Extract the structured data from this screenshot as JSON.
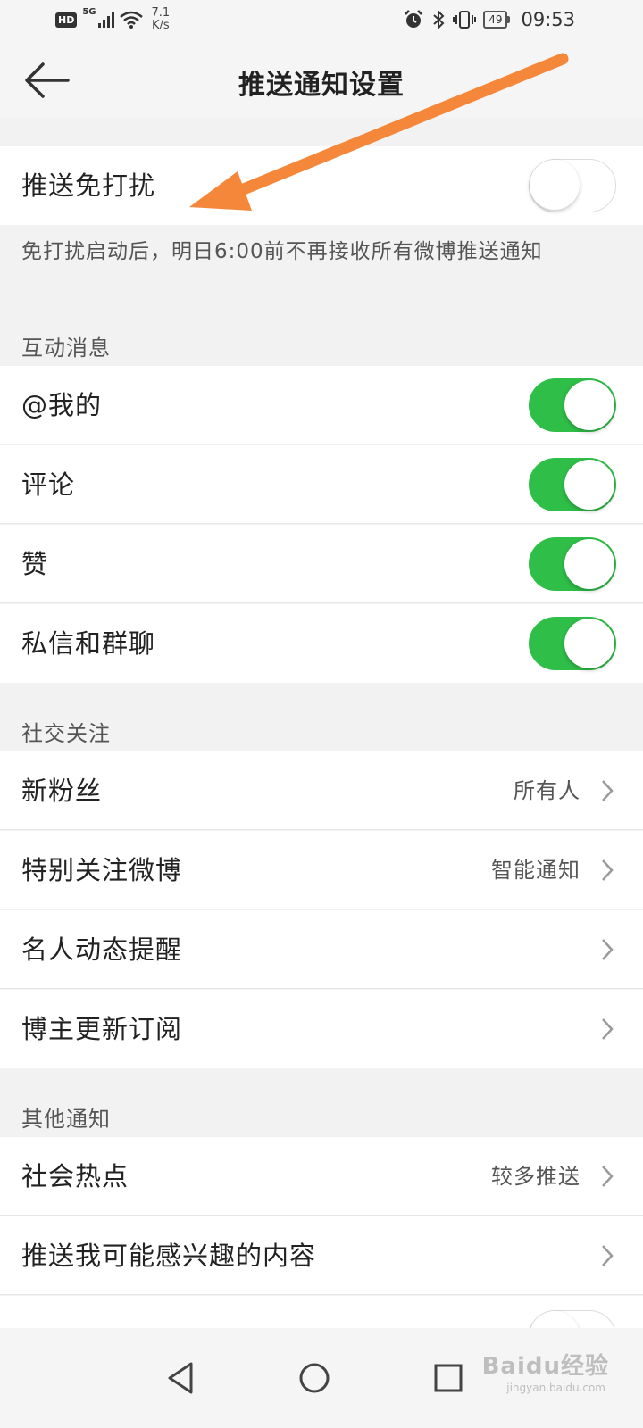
{
  "status_bar": {
    "hd": "HD",
    "network": "5G",
    "speed_value": "7.1",
    "speed_unit": "K/s",
    "battery": "49",
    "time": "09:53"
  },
  "header": {
    "title": "推送通知设置"
  },
  "dnd": {
    "label": "推送免打扰",
    "enabled": false,
    "note": "免打扰启动后，明日6:00前不再接收所有微博推送通知"
  },
  "sections": {
    "interaction": {
      "title": "互动消息",
      "items": [
        {
          "label": "@我的",
          "enabled": true
        },
        {
          "label": "评论",
          "enabled": true
        },
        {
          "label": "赞",
          "enabled": true
        },
        {
          "label": "私信和群聊",
          "enabled": true
        }
      ]
    },
    "social": {
      "title": "社交关注",
      "items": [
        {
          "label": "新粉丝",
          "value": "所有人"
        },
        {
          "label": "特别关注微博",
          "value": "智能通知"
        },
        {
          "label": "名人动态提醒",
          "value": ""
        },
        {
          "label": "博主更新订阅",
          "value": ""
        }
      ]
    },
    "other": {
      "title": "其他通知",
      "items": [
        {
          "label": "社会热点",
          "value": "较多推送"
        },
        {
          "label": "推送我可能感兴趣的内容",
          "value": ""
        }
      ]
    }
  },
  "colors": {
    "toggle_on": "#2fbe48",
    "annotation_arrow": "#f5873a"
  },
  "watermark": {
    "text": "Baidu经验",
    "sub": "jingyan.baidu.com"
  }
}
